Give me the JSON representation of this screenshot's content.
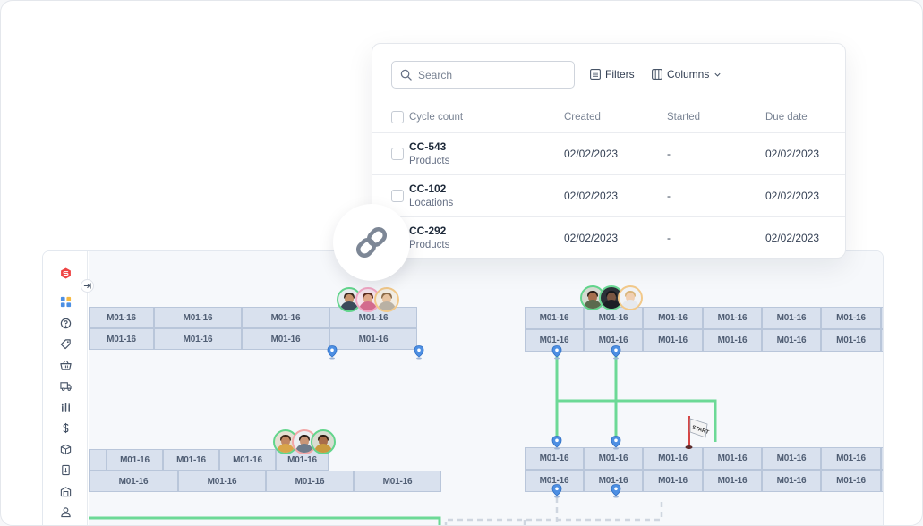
{
  "table": {
    "search": {
      "placeholder": "Search"
    },
    "toolbar": {
      "filters_label": "Filters",
      "columns_label": "Columns"
    },
    "columns": [
      "Cycle count",
      "Created",
      "Started",
      "Due date"
    ],
    "rows": [
      {
        "id": "CC-543",
        "type": "Products",
        "created": "02/02/2023",
        "started": "-",
        "due": "02/02/2023"
      },
      {
        "id": "CC-102",
        "type": "Locations",
        "created": "02/02/2023",
        "started": "-",
        "due": "02/02/2023"
      },
      {
        "id": "CC-292",
        "type": "Products",
        "created": "02/02/2023",
        "started": "-",
        "due": "02/02/2023"
      }
    ]
  },
  "link_icon": "link-icon",
  "map": {
    "logo_icon": "brand-s-hexagon-icon",
    "sidebar_icons": [
      "dashboard-icon",
      "help-icon",
      "tag-icon",
      "basket-icon",
      "truck-icon",
      "analytics-icon",
      "dollar-icon",
      "box-icon",
      "document-icon",
      "warehouse-icon",
      "user-icon"
    ],
    "collapse_icon": "expand-arrow-icon",
    "location_label": "M01-16",
    "start_label": "START",
    "colors": {
      "accent": "#6cd996",
      "shelf": "#d9e1ee",
      "pin": "#4d8fe3",
      "brand": "#ef4444"
    }
  }
}
